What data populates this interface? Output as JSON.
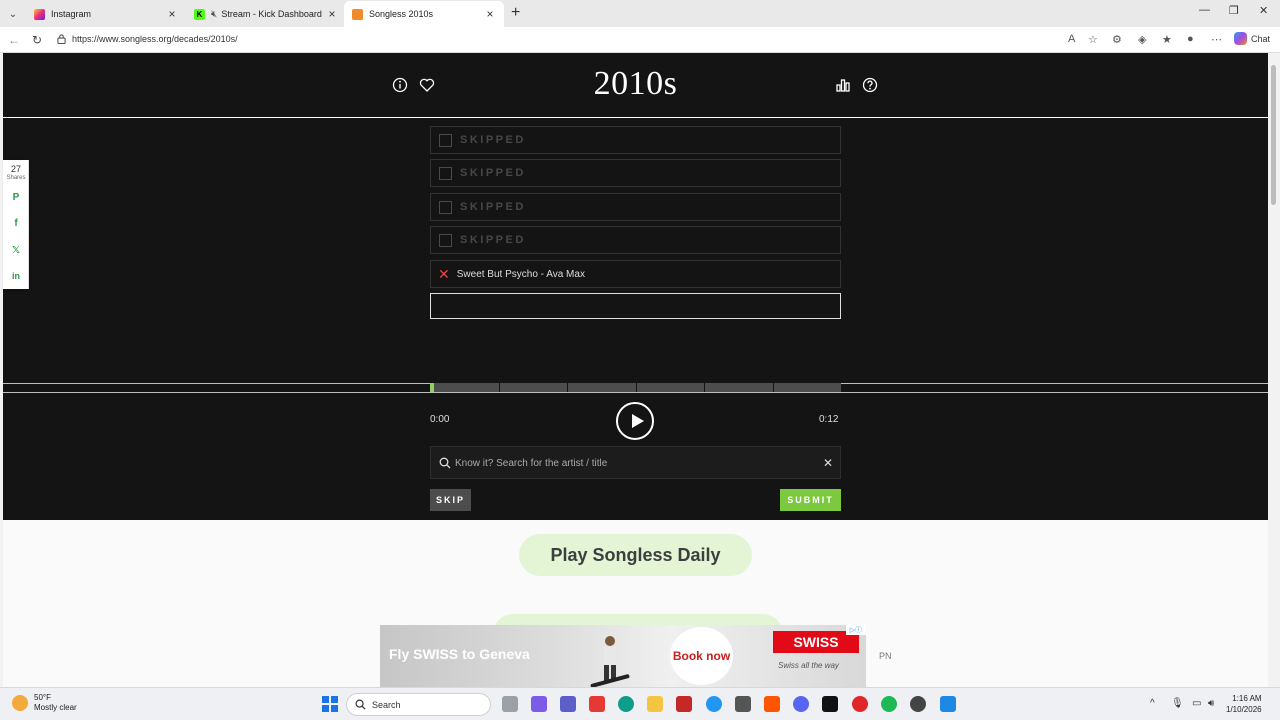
{
  "browser": {
    "tabs": [
      {
        "title": "Instagram",
        "favicon": "instagram-icon"
      },
      {
        "title": "Stream - Kick Dashboard",
        "favicon": "kick-icon",
        "muted": true
      },
      {
        "title": "Songless 2010s",
        "favicon": "songless-icon",
        "active": true
      }
    ],
    "url": "https://www.songless.org/decades/2010s/",
    "chat_label": "Chat"
  },
  "game": {
    "title": "2010s",
    "guesses": [
      {
        "status": "skipped",
        "text": "SKIPPED"
      },
      {
        "status": "skipped",
        "text": "SKIPPED"
      },
      {
        "status": "skipped",
        "text": "SKIPPED"
      },
      {
        "status": "skipped",
        "text": "SKIPPED"
      },
      {
        "status": "wrong",
        "text": "Sweet But Psycho - Ava Max"
      },
      {
        "status": "current",
        "text": ""
      }
    ],
    "progress_fraction": 0.01,
    "segments": 6,
    "time_current": "0:00",
    "time_total": "0:12",
    "search_placeholder": "Know it? Search for the artist / title",
    "skip_label": "SKIP",
    "submit_label": "SUBMIT"
  },
  "share_bar": {
    "count": "27",
    "label": "Shares",
    "networks": [
      "pinterest-icon",
      "facebook-icon",
      "x-icon",
      "linkedin-icon"
    ]
  },
  "promo": {
    "daily_label": "Play Songless Daily"
  },
  "ad": {
    "headline": "Fly SWISS to Geneva",
    "cta": "Book now",
    "brand": "SWISS",
    "slogan": "Swiss all the way",
    "corner_label": "PN"
  },
  "taskbar": {
    "weather_temp": "50°F",
    "weather_desc": "Mostly clear",
    "search_label": "Search",
    "time": "1:16 AM",
    "date": "1/10/2026"
  },
  "colors": {
    "accent_green": "#7cc93f",
    "page_bg": "#141414",
    "wrong_red": "#e44444"
  }
}
